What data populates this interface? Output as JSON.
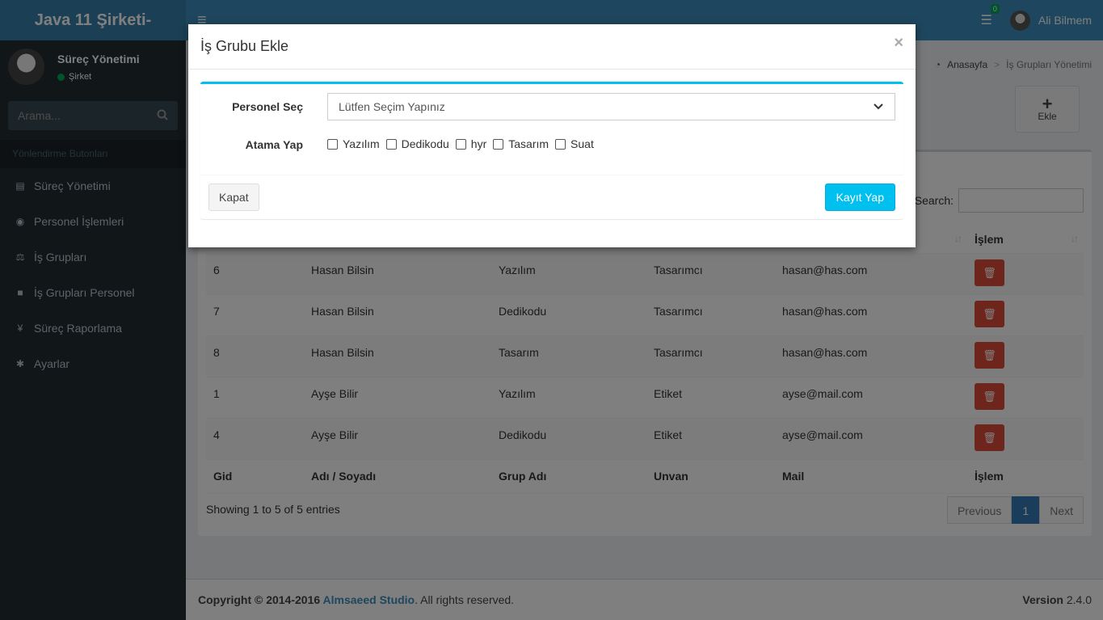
{
  "app": {
    "logo": "Java 11 Şirketi-"
  },
  "navbar": {
    "menu_icon": "≡",
    "tasks_count": "0",
    "user_name": "Ali Bilmem"
  },
  "sidebar": {
    "user_name": "Süreç Yönetimi",
    "user_status": "Şirket",
    "search_placeholder": "Arama...",
    "header": "Yönlendirme Butonları",
    "items": [
      {
        "label": "Süreç Yönetimi",
        "icon": "id-card-icon"
      },
      {
        "label": "Personel İşlemleri",
        "icon": "map-pin-icon"
      },
      {
        "label": "İş Grupları",
        "icon": "balance-scale-icon"
      },
      {
        "label": "İş Grupları Personel",
        "icon": "briefcase-icon"
      },
      {
        "label": "Süreç Raporlama",
        "icon": "child-icon"
      },
      {
        "label": "Ayarlar",
        "icon": "gear-icon"
      }
    ]
  },
  "breadcrumb": {
    "home": "Anasayfa",
    "current": "İş Grupları Yönetimi"
  },
  "add_button": {
    "label": "Ekle"
  },
  "table": {
    "search_label": "Search:",
    "columns": [
      "Gid",
      "Adı / Soyadı",
      "Grup Adı",
      "Unvan",
      "Mail",
      "İşlem"
    ],
    "rows": [
      {
        "gid": "6",
        "name": "Hasan Bilsin",
        "group": "Yazılım",
        "title": "Tasarımcı",
        "mail": "hasan@has.com"
      },
      {
        "gid": "7",
        "name": "Hasan Bilsin",
        "group": "Dedikodu",
        "title": "Tasarımcı",
        "mail": "hasan@has.com"
      },
      {
        "gid": "8",
        "name": "Hasan Bilsin",
        "group": "Tasarım",
        "title": "Tasarımcı",
        "mail": "hasan@has.com"
      },
      {
        "gid": "1",
        "name": "Ayşe Bilir",
        "group": "Yazılım",
        "title": "Etiket",
        "mail": "ayse@mail.com"
      },
      {
        "gid": "4",
        "name": "Ayşe Bilir",
        "group": "Dedikodu",
        "title": "Etiket",
        "mail": "ayse@mail.com"
      }
    ],
    "info": "Showing 1 to 5 of 5 entries",
    "pagination": {
      "previous": "Previous",
      "page": "1",
      "next": "Next"
    }
  },
  "footer": {
    "copyright_prefix": "Copyright © 2014-2016 ",
    "company": "Almsaeed Studio",
    "copyright_suffix": ". All rights reserved.",
    "version_label": "Version",
    "version": "2.4.0"
  },
  "modal": {
    "title": "İş Grubu Ekle",
    "close": "×",
    "personel_label": "Personel Seç",
    "personel_select": "Lütfen Seçim Yapınız",
    "atama_label": "Atama Yap",
    "options": [
      "Yazılım",
      "Dedikodu",
      "hyr",
      "Tasarım",
      "Suat"
    ],
    "close_button": "Kapat",
    "save_button": "Kayıt Yap"
  },
  "colors": {
    "header": "#3c8dbc",
    "logo": "#367fa9",
    "sidebar": "#222d32",
    "accent": "#00c0ef",
    "danger": "#dd4b39",
    "primary": "#337ab7"
  }
}
